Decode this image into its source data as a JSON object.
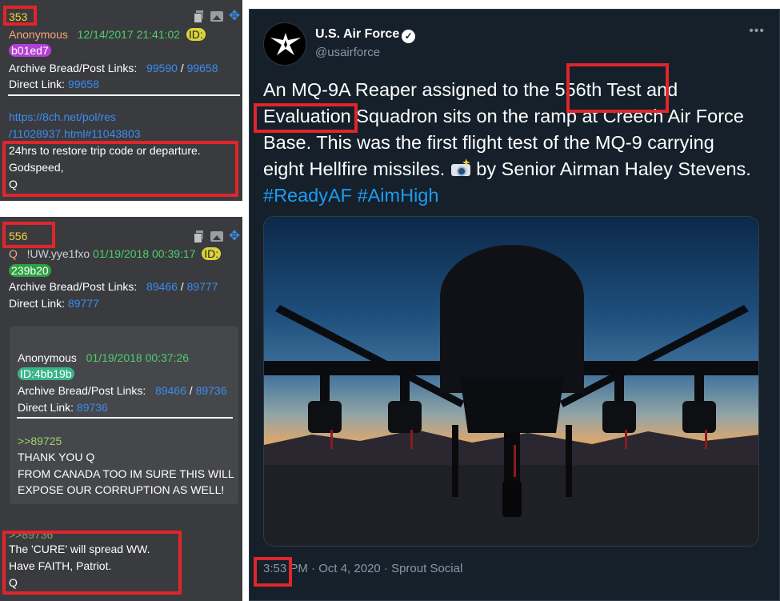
{
  "post1": {
    "number": "353",
    "author": "Anonymous",
    "datetime": "12/14/2017 21:41:02",
    "id_label": "ID:",
    "id_value": "b01ed7",
    "archive_label": "Archive Bread/Post Links:",
    "archive_link1": "99590",
    "separator": "/",
    "archive_link2": "99658",
    "direct_label": "Direct Link:",
    "direct_link": "99658",
    "url_line1": "https://8ch.net/pol/res",
    "url_line2": "/11028937.html#11043803",
    "body": [
      "24hrs to restore trip code or departure.",
      "Godspeed,",
      "Q"
    ]
  },
  "post2": {
    "number": "556",
    "author": "Q",
    "tripcode": "!UW.yye1fxo",
    "datetime": "01/19/2018 00:39:17",
    "id_label": "ID:",
    "id_value": "239b20",
    "archive_label": "Archive Bread/Post Links:",
    "archive_link1": "89466",
    "separator": "/",
    "archive_link2": "89777",
    "direct_label": "Direct Link:",
    "direct_link": "89777",
    "quoted": {
      "author": "Anonymous",
      "datetime": "01/19/2018 00:37:26",
      "id_value": "ID:4bb19b",
      "archive_label": "Archive Bread/Post Links:",
      "archive_link1": "89466",
      "separator": "/",
      "archive_link2": "89736",
      "direct_label": "Direct Link:",
      "direct_link": "89736",
      "reply_ref": ">>89725",
      "body": [
        "THANK YOU Q",
        "FROM CANADA TOO IM SURE THIS WILL",
        "EXPOSE OUR CORRUPTION AS WELL!"
      ]
    },
    "reply_ref": ">>89736",
    "body": [
      "The 'CURE' will spread WW.",
      "Have FAITH, Patriot.",
      "Q"
    ]
  },
  "tweet": {
    "display_name": "U.S. Air Force",
    "handle": "@usairforce",
    "more": "•••",
    "text_parts": {
      "a": "An MQ-9A Reaper assigned to the ",
      "b": "556th Test",
      "c": " and ",
      "d": "Evaluation",
      "e": " Squadron sits on the ramp at Creech Air Force Base. This was the first flight test of the MQ-9 carrying eight Hellfire missiles. ",
      "f": " by Senior Airman Haley Stevens. ",
      "hashtag1": "#ReadyAF",
      "hashtag2": "#AimHigh"
    },
    "footer": {
      "time": "3:53",
      "rest": " PM · Oct 4, 2020 · Sprout Social"
    }
  },
  "colors": {
    "highlight_box": "#e0252b",
    "chan_bg": "#3a3b3f",
    "tweet_bg": "#15202b",
    "link": "#3b8cf0",
    "hashtag": "#1d9bf0"
  }
}
